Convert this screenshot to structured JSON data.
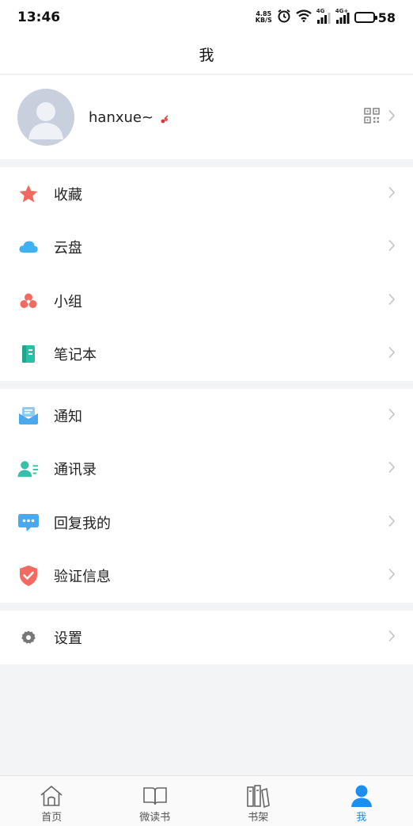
{
  "status_bar": {
    "time": "13:46",
    "speed_value": "4.85",
    "speed_unit": "KB/S",
    "battery": "58",
    "battery_level": 0.58,
    "network1": "4G",
    "network2": "4G+"
  },
  "header": {
    "title": "我"
  },
  "profile": {
    "username": "hanxue~"
  },
  "menu_group_1": [
    {
      "label": "收藏",
      "icon": "star-icon",
      "color": "#f06a62"
    },
    {
      "label": "云盘",
      "icon": "cloud-icon",
      "color": "#3fb1f2"
    },
    {
      "label": "小组",
      "icon": "group-icon",
      "color": "#f26a60"
    },
    {
      "label": "笔记本",
      "icon": "notebook-icon",
      "color": "#27c1a6"
    }
  ],
  "menu_group_2": [
    {
      "label": "通知",
      "icon": "mail-icon",
      "color": "#4aa8ef"
    },
    {
      "label": "通讯录",
      "icon": "contacts-icon",
      "color": "#36c0a9"
    },
    {
      "label": "回复我的",
      "icon": "chat-bubble-icon",
      "color": "#4aa8ef"
    },
    {
      "label": "验证信息",
      "icon": "shield-check-icon",
      "color": "#f36a62"
    }
  ],
  "menu_group_3": [
    {
      "label": "设置",
      "icon": "gear-icon",
      "color": "#777777"
    }
  ],
  "tabbar": [
    {
      "label": "首页",
      "icon": "home-icon"
    },
    {
      "label": "微读书",
      "icon": "book-icon"
    },
    {
      "label": "书架",
      "icon": "bookshelf-icon"
    },
    {
      "label": "我",
      "icon": "person-icon",
      "active": true
    }
  ],
  "colors": {
    "accent": "#1b8ef0",
    "background": "#f3f4f6"
  }
}
